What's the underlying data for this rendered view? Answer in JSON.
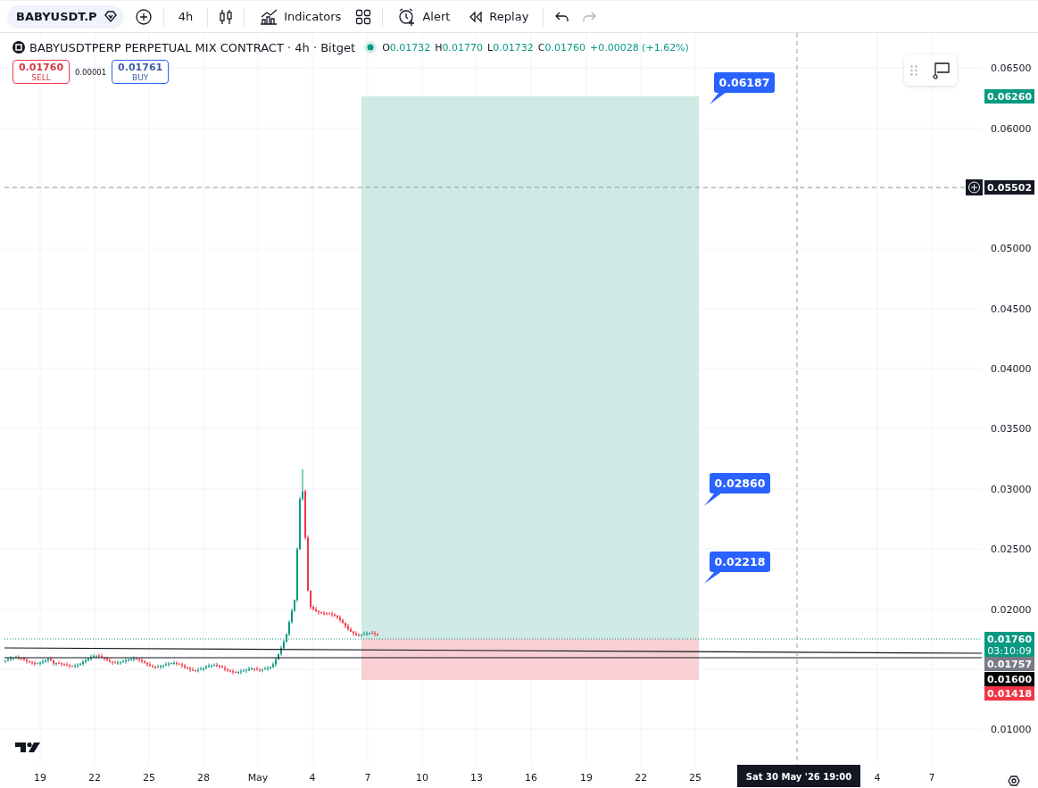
{
  "toolbar": {
    "symbol": "BABYUSDT.P",
    "interval": "4h",
    "buttons": [
      {
        "kind": "indicators",
        "label": "Indicators"
      },
      {
        "kind": "layouts"
      },
      {
        "kind": "alert",
        "label": "Alert"
      },
      {
        "kind": "replay",
        "label": "Replay"
      }
    ]
  },
  "legend": {
    "title": "BABYUSDTPERP PERPETUAL MIX CONTRACT · 4h · Bitget",
    "ohlc": [
      {
        "key": "O",
        "value": "0.01732"
      },
      {
        "key": "H",
        "value": "0.01770"
      },
      {
        "key": "L",
        "value": "0.01732"
      },
      {
        "key": "C",
        "value": "0.01760"
      }
    ],
    "change": "+0.00028 (+1.62%)"
  },
  "trade": {
    "sell": {
      "price": "0.01760",
      "label": "SELL"
    },
    "spread": "0.00001",
    "buy": {
      "price": "0.01761",
      "label": "BUY"
    }
  },
  "price_axis": {
    "ticks": [
      "0.06500",
      "0.06000",
      "0.05000",
      "0.04500",
      "0.04000",
      "0.03500",
      "0.03000",
      "0.02500",
      "0.02000",
      "0.01000"
    ],
    "badges": [
      {
        "kind": "price",
        "text": "0.06260",
        "color": "#089981"
      },
      {
        "kind": "crosshair",
        "text": "0.05502",
        "color": "#131722"
      },
      {
        "kind": "price",
        "text": "0.01760",
        "sublabel": "03:10:09",
        "color": "#089981"
      },
      {
        "kind": "price",
        "text": "0.01757",
        "color": "#787b86"
      },
      {
        "kind": "price",
        "text": "0.01600",
        "color": "#000000"
      },
      {
        "kind": "price",
        "text": "0.01418",
        "color": "#f23645"
      }
    ]
  },
  "time_axis": {
    "ticks": [
      "19",
      "22",
      "25",
      "28",
      "May",
      "4",
      "7",
      "10",
      "13",
      "16",
      "19",
      "22",
      "25",
      "4",
      "7"
    ],
    "crosshair_label": "Sat 30 May '26 19:00"
  },
  "callouts": [
    "0.06187",
    "0.02860",
    "0.02218"
  ]
}
